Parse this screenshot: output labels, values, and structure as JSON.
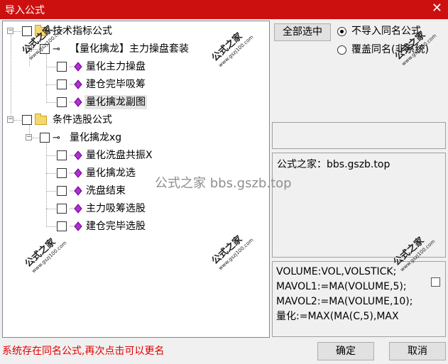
{
  "window": {
    "title": "导入公式",
    "close_glyph": "✕"
  },
  "tree": {
    "group1": {
      "label": "技术指标公式"
    },
    "formula1": {
      "label": "【量化擒龙】主力操盘套装"
    },
    "items1": [
      "量化主力操盘",
      "建仓完毕吸筹",
      "量化擒龙副图"
    ],
    "group2": {
      "label": "条件选股公式"
    },
    "formula2": {
      "label": "量化擒龙xg"
    },
    "items2": [
      "量化洗盘共振X",
      "量化擒龙选",
      "洗盘结束",
      "主力吸筹选股",
      "建仓完毕选股"
    ]
  },
  "controls": {
    "select_all": "全部选中",
    "radio_skip": "不导入同名公式",
    "radio_overwrite": "覆盖同名(非系统)"
  },
  "site_text": "公式之家：bbs.gszb.top",
  "code_lines": [
    "VOLUME:VOL,VOLSTICK;",
    "MAVOL1:=MA(VOLUME,5);",
    "MAVOL2:=MA(VOLUME,10);",
    "量化:=MAX(MA(C,5),MAX"
  ],
  "status": "系统存在同名公式,再次点击可以更名",
  "buttons": {
    "ok": "确定",
    "cancel": "取消"
  },
  "watermark": {
    "center": "公式之家 bbs.gszb.top",
    "stamp_title": "公式之家",
    "stamp_url": "www.gszj100.com"
  },
  "colors": {
    "title_bar": "#cc1010",
    "status_text": "#e00000",
    "diamond": "#b030d0"
  }
}
